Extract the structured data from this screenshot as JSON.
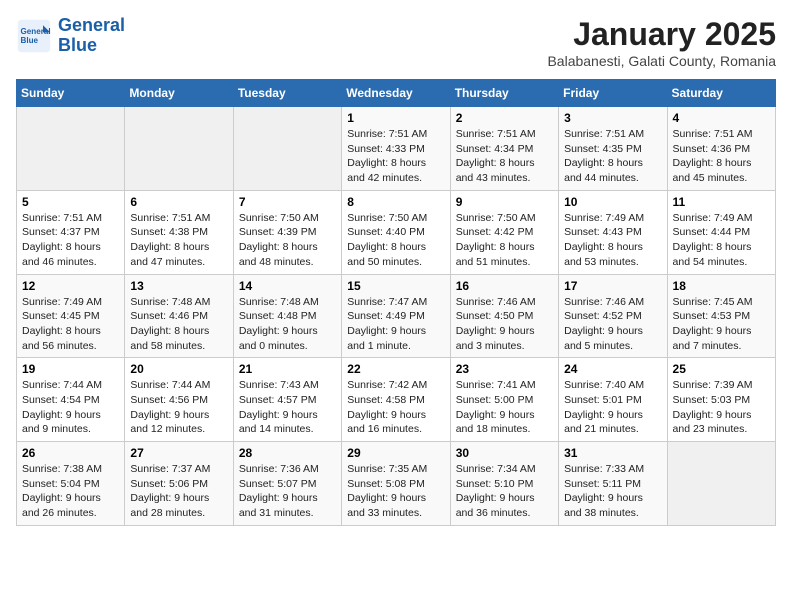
{
  "header": {
    "logo_line1": "General",
    "logo_line2": "Blue",
    "month": "January 2025",
    "location": "Balabanesti, Galati County, Romania"
  },
  "weekdays": [
    "Sunday",
    "Monday",
    "Tuesday",
    "Wednesday",
    "Thursday",
    "Friday",
    "Saturday"
  ],
  "weeks": [
    [
      {
        "day": "",
        "info": ""
      },
      {
        "day": "",
        "info": ""
      },
      {
        "day": "",
        "info": ""
      },
      {
        "day": "1",
        "info": "Sunrise: 7:51 AM\nSunset: 4:33 PM\nDaylight: 8 hours and 42 minutes."
      },
      {
        "day": "2",
        "info": "Sunrise: 7:51 AM\nSunset: 4:34 PM\nDaylight: 8 hours and 43 minutes."
      },
      {
        "day": "3",
        "info": "Sunrise: 7:51 AM\nSunset: 4:35 PM\nDaylight: 8 hours and 44 minutes."
      },
      {
        "day": "4",
        "info": "Sunrise: 7:51 AM\nSunset: 4:36 PM\nDaylight: 8 hours and 45 minutes."
      }
    ],
    [
      {
        "day": "5",
        "info": "Sunrise: 7:51 AM\nSunset: 4:37 PM\nDaylight: 8 hours and 46 minutes."
      },
      {
        "day": "6",
        "info": "Sunrise: 7:51 AM\nSunset: 4:38 PM\nDaylight: 8 hours and 47 minutes."
      },
      {
        "day": "7",
        "info": "Sunrise: 7:50 AM\nSunset: 4:39 PM\nDaylight: 8 hours and 48 minutes."
      },
      {
        "day": "8",
        "info": "Sunrise: 7:50 AM\nSunset: 4:40 PM\nDaylight: 8 hours and 50 minutes."
      },
      {
        "day": "9",
        "info": "Sunrise: 7:50 AM\nSunset: 4:42 PM\nDaylight: 8 hours and 51 minutes."
      },
      {
        "day": "10",
        "info": "Sunrise: 7:49 AM\nSunset: 4:43 PM\nDaylight: 8 hours and 53 minutes."
      },
      {
        "day": "11",
        "info": "Sunrise: 7:49 AM\nSunset: 4:44 PM\nDaylight: 8 hours and 54 minutes."
      }
    ],
    [
      {
        "day": "12",
        "info": "Sunrise: 7:49 AM\nSunset: 4:45 PM\nDaylight: 8 hours and 56 minutes."
      },
      {
        "day": "13",
        "info": "Sunrise: 7:48 AM\nSunset: 4:46 PM\nDaylight: 8 hours and 58 minutes."
      },
      {
        "day": "14",
        "info": "Sunrise: 7:48 AM\nSunset: 4:48 PM\nDaylight: 9 hours and 0 minutes."
      },
      {
        "day": "15",
        "info": "Sunrise: 7:47 AM\nSunset: 4:49 PM\nDaylight: 9 hours and 1 minute."
      },
      {
        "day": "16",
        "info": "Sunrise: 7:46 AM\nSunset: 4:50 PM\nDaylight: 9 hours and 3 minutes."
      },
      {
        "day": "17",
        "info": "Sunrise: 7:46 AM\nSunset: 4:52 PM\nDaylight: 9 hours and 5 minutes."
      },
      {
        "day": "18",
        "info": "Sunrise: 7:45 AM\nSunset: 4:53 PM\nDaylight: 9 hours and 7 minutes."
      }
    ],
    [
      {
        "day": "19",
        "info": "Sunrise: 7:44 AM\nSunset: 4:54 PM\nDaylight: 9 hours and 9 minutes."
      },
      {
        "day": "20",
        "info": "Sunrise: 7:44 AM\nSunset: 4:56 PM\nDaylight: 9 hours and 12 minutes."
      },
      {
        "day": "21",
        "info": "Sunrise: 7:43 AM\nSunset: 4:57 PM\nDaylight: 9 hours and 14 minutes."
      },
      {
        "day": "22",
        "info": "Sunrise: 7:42 AM\nSunset: 4:58 PM\nDaylight: 9 hours and 16 minutes."
      },
      {
        "day": "23",
        "info": "Sunrise: 7:41 AM\nSunset: 5:00 PM\nDaylight: 9 hours and 18 minutes."
      },
      {
        "day": "24",
        "info": "Sunrise: 7:40 AM\nSunset: 5:01 PM\nDaylight: 9 hours and 21 minutes."
      },
      {
        "day": "25",
        "info": "Sunrise: 7:39 AM\nSunset: 5:03 PM\nDaylight: 9 hours and 23 minutes."
      }
    ],
    [
      {
        "day": "26",
        "info": "Sunrise: 7:38 AM\nSunset: 5:04 PM\nDaylight: 9 hours and 26 minutes."
      },
      {
        "day": "27",
        "info": "Sunrise: 7:37 AM\nSunset: 5:06 PM\nDaylight: 9 hours and 28 minutes."
      },
      {
        "day": "28",
        "info": "Sunrise: 7:36 AM\nSunset: 5:07 PM\nDaylight: 9 hours and 31 minutes."
      },
      {
        "day": "29",
        "info": "Sunrise: 7:35 AM\nSunset: 5:08 PM\nDaylight: 9 hours and 33 minutes."
      },
      {
        "day": "30",
        "info": "Sunrise: 7:34 AM\nSunset: 5:10 PM\nDaylight: 9 hours and 36 minutes."
      },
      {
        "day": "31",
        "info": "Sunrise: 7:33 AM\nSunset: 5:11 PM\nDaylight: 9 hours and 38 minutes."
      },
      {
        "day": "",
        "info": ""
      }
    ]
  ]
}
